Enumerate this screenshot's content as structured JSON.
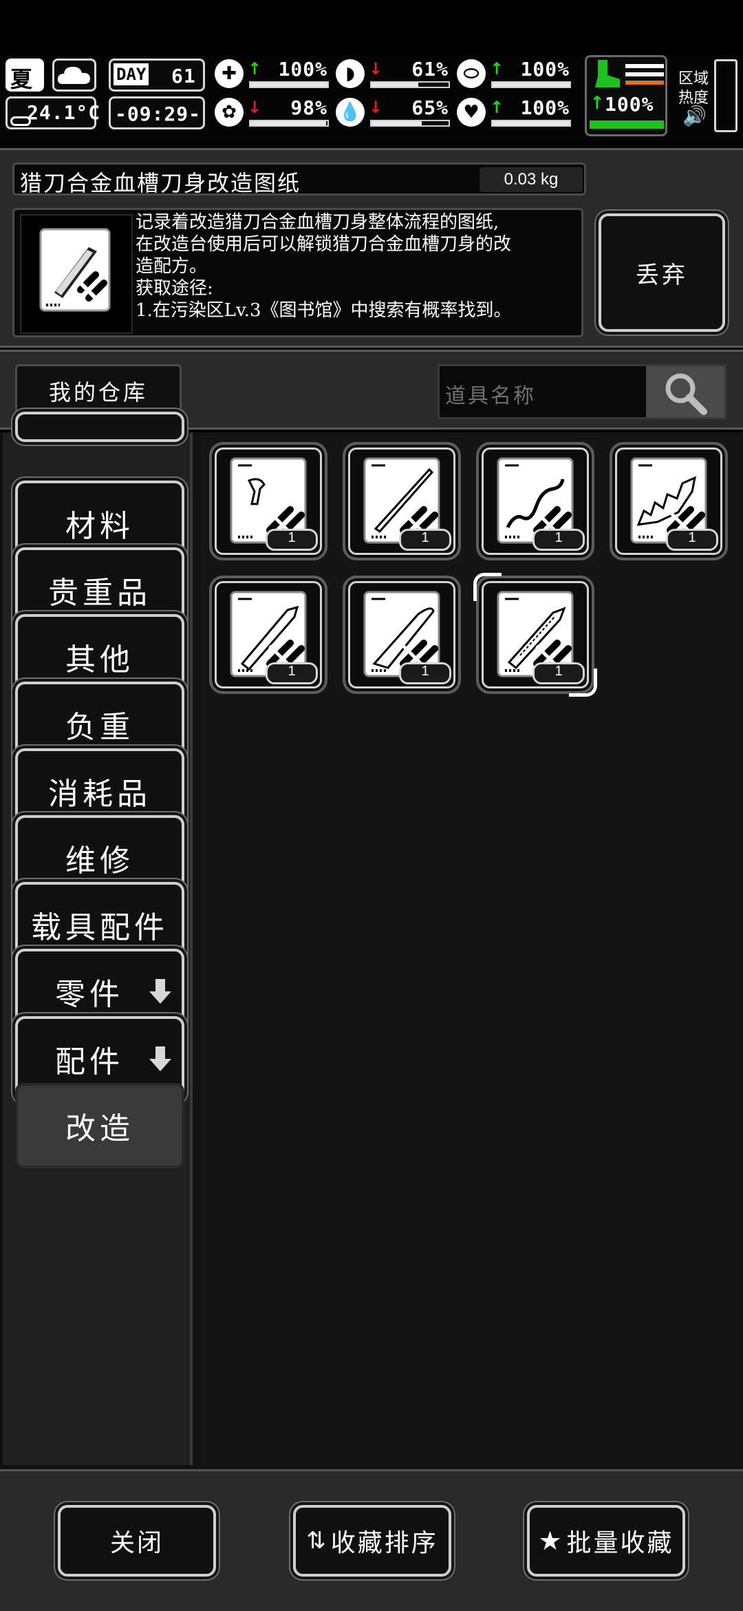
{
  "status": {
    "season": "夏",
    "temperature": "24.1°C",
    "day_label": "DAY",
    "day_number": "61",
    "clock": "-09:29-",
    "stats": [
      {
        "icon": "medkit-icon",
        "trend": "up",
        "value": "100%",
        "level": 1.0
      },
      {
        "icon": "stomach-icon",
        "trend": "down",
        "value": "61%",
        "level": 0.61
      },
      {
        "icon": "pill-icon",
        "trend": "up",
        "value": "100%",
        "level": 1.0
      },
      {
        "icon": "brain-icon",
        "trend": "down",
        "value": "98%",
        "level": 0.98
      },
      {
        "icon": "water-drop-icon",
        "trend": "down",
        "value": "65%",
        "level": 0.65
      },
      {
        "icon": "heart-icon",
        "trend": "up",
        "value": "100%",
        "level": 1.0
      }
    ],
    "stamina": {
      "trend": "up",
      "value": "100%",
      "level": 1.0
    },
    "zone_heat_label_1": "区域",
    "zone_heat_label_2": "热度"
  },
  "item": {
    "name": "猎刀合金血槽刀身改造图纸",
    "weight": "0.03 kg",
    "description_1": "记录着改造猎刀合金血槽刀身整体流程的图纸,",
    "description_2": "在改造台使用后可以解锁猎刀合金血槽刀身的改",
    "description_3": "造配方。",
    "description_4": "获取途径:",
    "description_5": "1.在污染区Lv.3《图书馆》中搜索有概率找到。",
    "discard_label": "丢弃"
  },
  "storage": {
    "title": "我的仓库",
    "search_placeholder": "道具名称"
  },
  "sidebar": {
    "items": [
      {
        "label": "材料"
      },
      {
        "label": "贵重品"
      },
      {
        "label": "其他"
      },
      {
        "label": "负重"
      },
      {
        "label": "消耗品"
      },
      {
        "label": "维修"
      },
      {
        "label": "载具配件"
      },
      {
        "label": "零件"
      },
      {
        "label": "配件"
      },
      {
        "label": "改造"
      }
    ]
  },
  "grid": {
    "items": [
      {
        "icon": "trigger-blueprint-icon",
        "qty": "1"
      },
      {
        "icon": "spear-blueprint-icon",
        "qty": "1"
      },
      {
        "icon": "wavy-blade-blueprint-icon",
        "qty": "1"
      },
      {
        "icon": "serrated-blade-blueprint-icon",
        "qty": "1"
      },
      {
        "icon": "knife-blueprint-icon",
        "qty": "1"
      },
      {
        "icon": "machete-blueprint-icon",
        "qty": "1"
      },
      {
        "icon": "blood-groove-blade-blueprint-icon",
        "qty": "1"
      }
    ]
  },
  "footer": {
    "close_label": "关闭",
    "sort_label": "收藏排序",
    "batch_label": "批量收藏"
  }
}
